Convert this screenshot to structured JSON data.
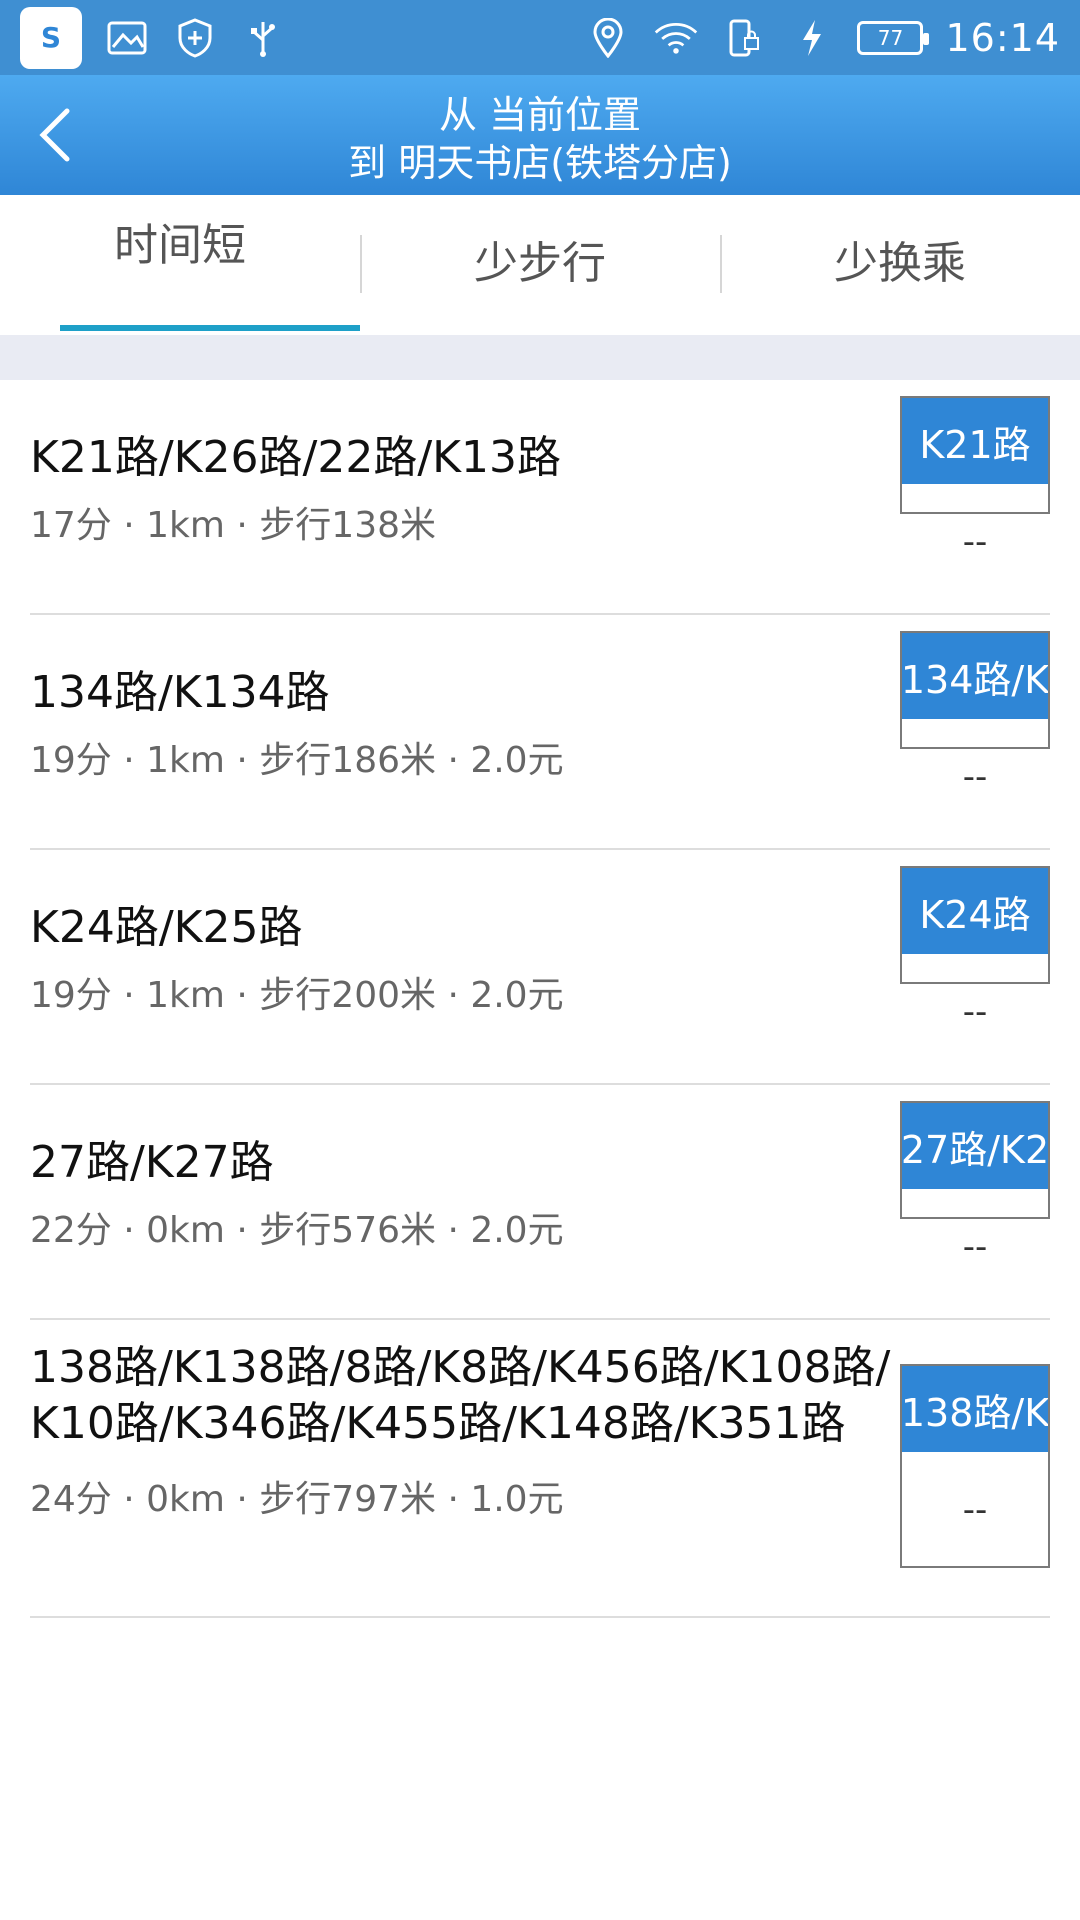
{
  "status_bar": {
    "app_icon": "shopping-bag-icon",
    "icons": [
      "image-icon",
      "shield-plus-icon",
      "usb-icon"
    ],
    "right_icons": [
      "location-pin-icon",
      "wifi-icon",
      "phone-lock-icon",
      "charging-bolt-icon"
    ],
    "battery": "77",
    "time": "16:14"
  },
  "header": {
    "line1": "从 当前位置",
    "line2": "到 明天书店(铁塔分店)"
  },
  "tabs": [
    {
      "label": "时间短",
      "active": true
    },
    {
      "label": "少步行",
      "active": false
    },
    {
      "label": "少换乘",
      "active": false
    }
  ],
  "routes": [
    {
      "title": "K21路/K26路/22路/K13路",
      "meta": "17分 · 1km · 步行138米",
      "badge_label": "K21路",
      "badge_status": "--"
    },
    {
      "title": "134路/K134路",
      "meta": "19分 · 1km · 步行186米 · 2.0元",
      "badge_label": "134路/K",
      "badge_status": "--"
    },
    {
      "title": "K24路/K25路",
      "meta": "19分 · 1km · 步行200米 · 2.0元",
      "badge_label": "K24路",
      "badge_status": "--"
    },
    {
      "title": "27路/K27路",
      "meta": "22分 · 0km · 步行576米 · 2.0元",
      "badge_label": "27路/K2",
      "badge_status": "--"
    },
    {
      "title": "138路/K138路/8路/K8路/K456路/K108路/K10路/K346路/K455路/K148路/K351路",
      "meta": "24分 · 0km · 步行797米 · 1.0元",
      "badge_label": "138路/K",
      "badge_status": "--"
    }
  ]
}
